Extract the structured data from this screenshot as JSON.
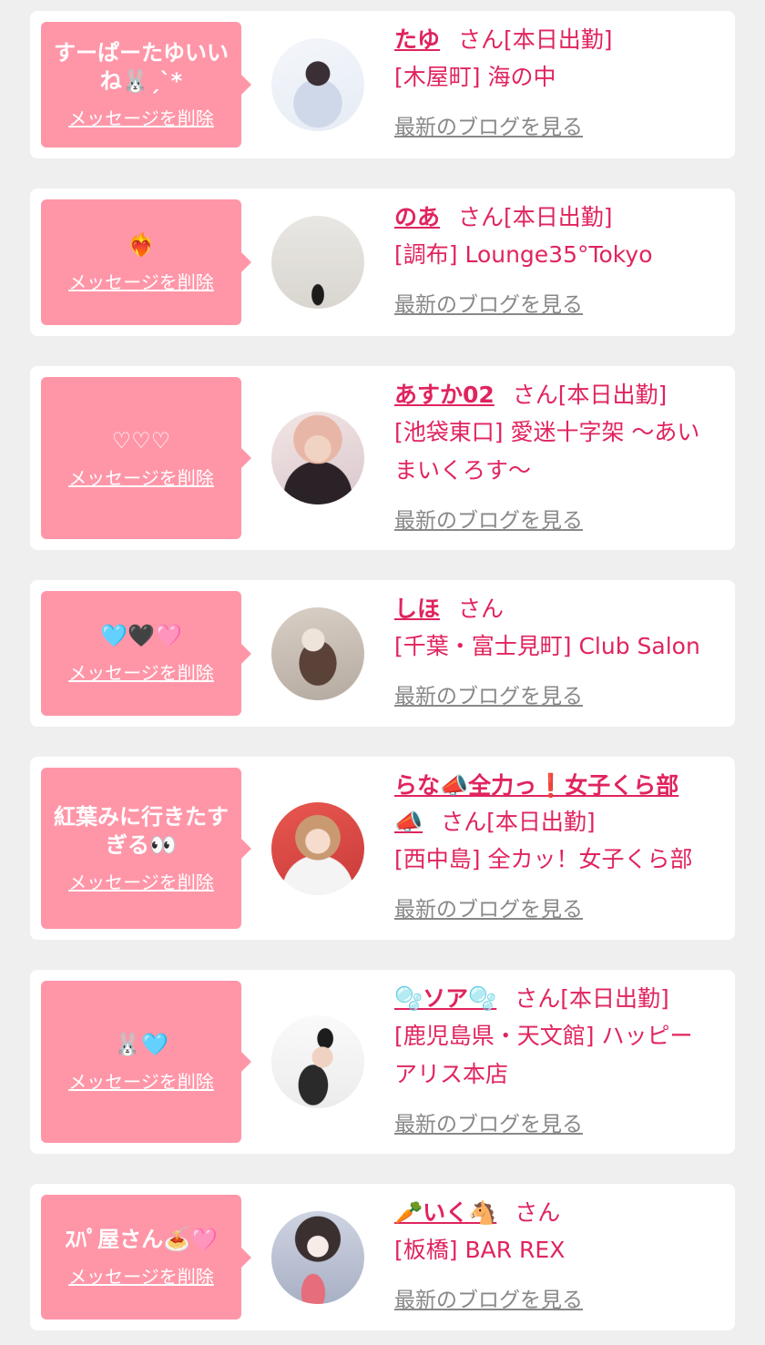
{
  "delete_label": "メッセージを削除",
  "blog_label": "最新のブログを見る",
  "accent_color": "#e0245e",
  "bubble_color": "#ff96a8",
  "entries": [
    {
      "message": "すーぱーたゆいいね🐰ˏˋ*",
      "name": "たゆ",
      "suffix": "さん[本日出勤]",
      "shop": "[木屋町] 海の中",
      "avatar": "photo of girl with dark hair"
    },
    {
      "message": "❤️‍🔥",
      "name": "のあ",
      "suffix": "さん[本日出勤]",
      "shop": "[調布] Lounge35°Tokyo",
      "avatar": "photo of silhouette with hanging branches"
    },
    {
      "message": "♡♡♡",
      "name": "あすか02",
      "suffix": "さん[本日出勤]",
      "shop": "[池袋東口] 愛迷十字架 〜あいまいくろす〜",
      "avatar": "photo of girl with pink-blonde hair"
    },
    {
      "message": "🩵🖤🩷",
      "name": "しほ",
      "suffix": "さん",
      "shop": "[千葉・富士見町] Club Salon",
      "avatar": "mirror selfie photo"
    },
    {
      "message": "紅葉みに行きたすぎる👀",
      "name": "らな📣全力っ❗女子くら部📣",
      "suffix": "さん[本日出勤]",
      "shop": "[西中島] 全カッ！女子くら部",
      "avatar": "photo of girl on red background"
    },
    {
      "message": "🐰🩵",
      "name": "🫧ソア🫧",
      "suffix": "さん[本日出勤]",
      "shop": "[鹿児島県・天文館] ハッピーアリス本店",
      "avatar": "photo of girl with bunny ears"
    },
    {
      "message": "ｽﾊﾟ屋さん🍝🩷",
      "name": "🥕いく🐴",
      "suffix": "さん",
      "shop": "[板橋] BAR REX",
      "avatar": "photo of girl with cake"
    }
  ]
}
